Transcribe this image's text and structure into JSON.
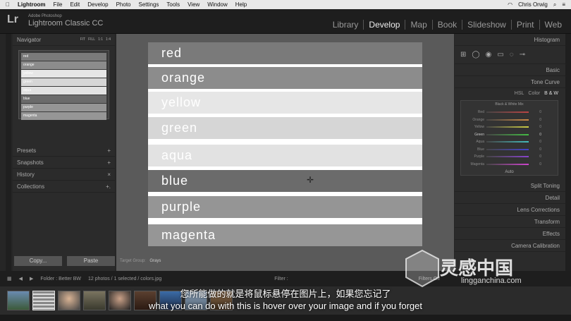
{
  "menubar": {
    "apple": "",
    "app": "Lightroom",
    "items": [
      "File",
      "Edit",
      "Develop",
      "Photo",
      "Settings",
      "Tools",
      "View",
      "Window",
      "Help"
    ],
    "user": "Chris Orwig"
  },
  "identity": {
    "logo": "Lr",
    "vendor": "Adobe Photoshop",
    "product": "Lightroom Classic CC"
  },
  "modules": [
    "Library",
    "Develop",
    "Map",
    "Book",
    "Slideshow",
    "Print",
    "Web"
  ],
  "left_panel": {
    "navigator": "Navigator",
    "nav_opts": [
      "FIT",
      "FILL",
      "1:1",
      "1:4"
    ],
    "nav_items": [
      "red",
      "orange",
      "yellow",
      "green",
      "aqua",
      "blue",
      "purple",
      "magenta"
    ],
    "sections": [
      {
        "label": "Presets",
        "icon": "+"
      },
      {
        "label": "Snapshots",
        "icon": "+"
      },
      {
        "label": "History",
        "icon": "×"
      },
      {
        "label": "Collections",
        "icon": "+."
      }
    ],
    "copy": "Copy...",
    "paste": "Paste"
  },
  "photo_stripes": [
    {
      "label": "red",
      "color": "#7a7a7a"
    },
    {
      "label": "orange",
      "color": "#8c8c8c"
    },
    {
      "label": "yellow",
      "color": "#e6e6e6"
    },
    {
      "label": "green",
      "color": "#d6d6d6"
    },
    {
      "label": "aqua",
      "color": "#e2e2e2"
    },
    {
      "label": "blue",
      "color": "#6b6b6b"
    },
    {
      "label": "purple",
      "color": "#959595"
    },
    {
      "label": "magenta",
      "color": "#969696"
    }
  ],
  "target_group": {
    "label": "Target Group:",
    "value": "Grays"
  },
  "right_panel": {
    "histogram": "Histogram",
    "basic": "Basic",
    "tone_curve": "Tone Curve",
    "hsl_tabs": [
      "HSL",
      "Color",
      "B & W"
    ],
    "mixer_title": "Black & White Mix",
    "sliders": [
      {
        "label": "Red",
        "value": "0"
      },
      {
        "label": "Orange",
        "value": "0"
      },
      {
        "label": "Yellow",
        "value": "0"
      },
      {
        "label": "Green",
        "value": "0"
      },
      {
        "label": "Aqua",
        "value": "0"
      },
      {
        "label": "Blue",
        "value": "0"
      },
      {
        "label": "Purple",
        "value": "0"
      },
      {
        "label": "Magenta",
        "value": "0"
      }
    ],
    "auto": "Auto",
    "sections": [
      "Split Toning",
      "Detail",
      "Lens Corrections",
      "Transform",
      "Effects",
      "Camera Calibration"
    ]
  },
  "filmbar": {
    "folder": "Folder : Better BW",
    "count": "12 photos / 1 selected / colors.jpg",
    "filter": "Filter :",
    "filters_off": "Filters Off"
  },
  "subtitles": {
    "zh": "您所能做的就是将鼠标悬停在图片上，如果您忘记了",
    "en": "what you can do with this is hover over your image and if you forget"
  },
  "watermark": {
    "cn": "灵感中国",
    "url": "lingganchina.com"
  }
}
